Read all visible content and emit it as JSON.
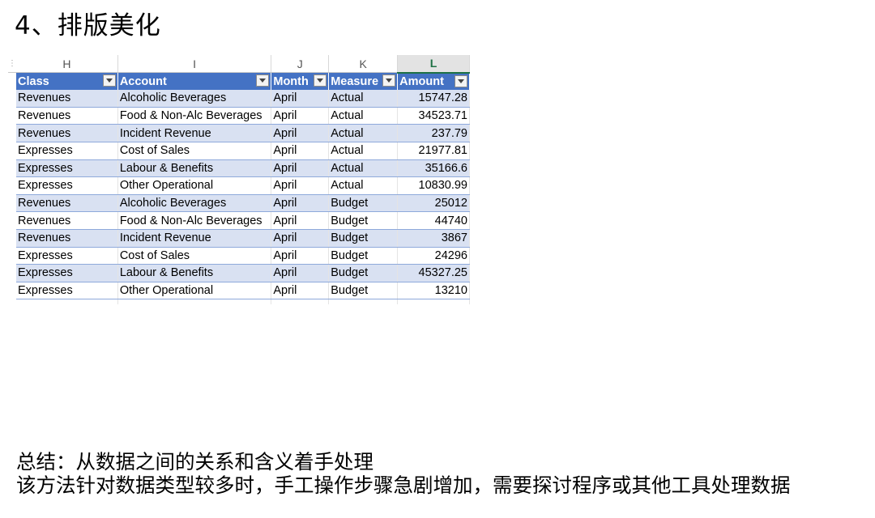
{
  "slide": {
    "title": "4、排版美化",
    "summary_line1": "总结：从数据之间的关系和含义着手处理",
    "summary_line2": "该方法针对数据类型较多时，手工操作步骤急剧增加，需要探讨程序或其他工具处理数据"
  },
  "spreadsheet": {
    "column_letters": [
      "H",
      "I",
      "J",
      "K",
      "L"
    ],
    "selected_column": "L",
    "headers": [
      "Class",
      "Account",
      "Month",
      "Measure",
      "Amount"
    ],
    "rows": [
      [
        "Revenues",
        "Alcoholic Beverages",
        "April",
        "Actual",
        "15747.28"
      ],
      [
        "Revenues",
        "Food & Non-Alc Beverages",
        "April",
        "Actual",
        "34523.71"
      ],
      [
        "Revenues",
        "Incident Revenue",
        "April",
        "Actual",
        "237.79"
      ],
      [
        "Expresses",
        "Cost of Sales",
        "April",
        "Actual",
        "21977.81"
      ],
      [
        "Expresses",
        "Labour & Benefits",
        "April",
        "Actual",
        "35166.6"
      ],
      [
        "Expresses",
        "Other  Operational",
        "April",
        "Actual",
        "10830.99"
      ],
      [
        "Revenues",
        "Alcoholic Beverages",
        "April",
        "Budget",
        "25012"
      ],
      [
        "Revenues",
        "Food & Non-Alc Beverages",
        "April",
        "Budget",
        "44740"
      ],
      [
        "Revenues",
        "Incident Revenue",
        "April",
        "Budget",
        "3867"
      ],
      [
        "Expresses",
        "Cost of Sales",
        "April",
        "Budget",
        "24296"
      ],
      [
        "Expresses",
        "Labour & Benefits",
        "April",
        "Budget",
        "45327.25"
      ],
      [
        "Expresses",
        "Other  Operational",
        "April",
        "Budget",
        "13210"
      ]
    ],
    "colors": {
      "header_fill": "#4472c4",
      "band_fill": "#d9e1f2",
      "selected_column_text": "#1e7145"
    }
  }
}
